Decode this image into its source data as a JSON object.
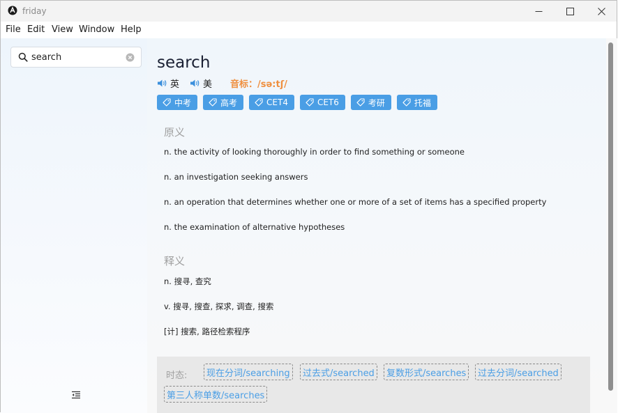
{
  "window": {
    "title": "friday"
  },
  "menu": [
    "File",
    "Edit",
    "View",
    "Window",
    "Help"
  ],
  "search": {
    "value": "search",
    "placeholder": ""
  },
  "entry": {
    "word": "search",
    "pron_uk": "英",
    "pron_us": "美",
    "phonetic": "音标：/sə:tʃ/",
    "tags": [
      "中考",
      "高考",
      "CET4",
      "CET6",
      "考研",
      "托福"
    ],
    "original_title": "原义",
    "original_defs": [
      "n. the activity of looking thoroughly in order to find something or someone",
      "n. an investigation seeking answers",
      "n. an operation that determines whether one or more of a set of items has a specified property",
      "n. the examination of alternative hypotheses"
    ],
    "translation_title": "释义",
    "translation_defs": [
      "n. 搜寻, 查究",
      "v. 搜寻, 搜查, 探求, 调查, 搜索",
      "[计] 搜索, 路径检索程序"
    ],
    "tense_label": "时态:",
    "tenses": [
      "现在分词/searching",
      "过去式/searched",
      "复数形式/searches",
      "过去分词/searched",
      "第三人称单数/searches"
    ]
  },
  "colors": {
    "accent": "#4a9ee5",
    "phonetic": "#ef8f3f",
    "section": "#a0a0a0"
  }
}
